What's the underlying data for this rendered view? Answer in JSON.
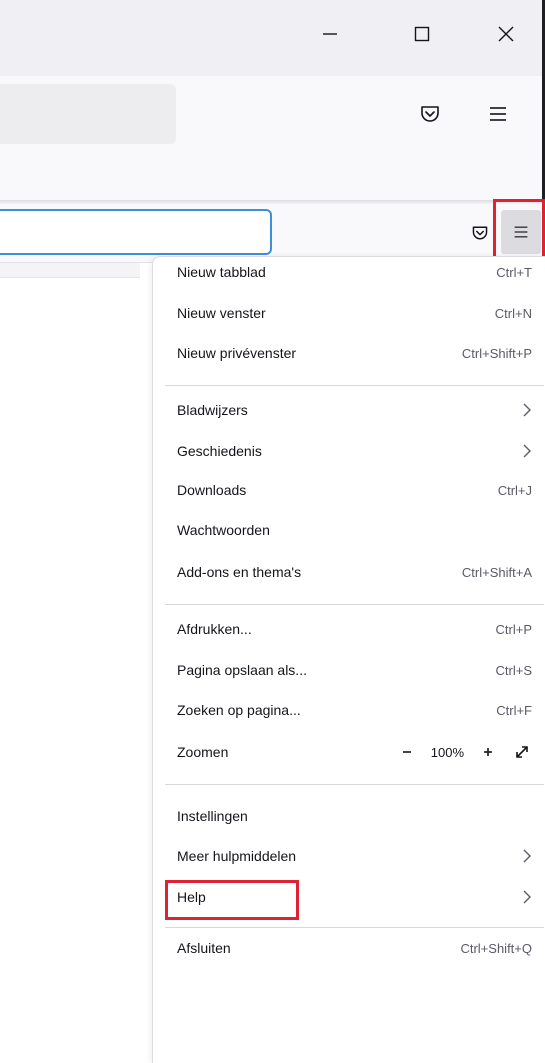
{
  "window": {
    "minimize_icon": "minimize-icon",
    "maximize_icon": "maximize-icon",
    "close_icon": "close-icon"
  },
  "toolbar": {
    "pocket_icon": "pocket-icon",
    "menu_icon": "hamburger-menu-icon"
  },
  "menu": {
    "items": [
      {
        "label": "Nieuw tabblad",
        "shortcut": "Ctrl+T"
      },
      {
        "label": "Nieuw venster",
        "shortcut": "Ctrl+N"
      },
      {
        "label": "Nieuw privévenster",
        "shortcut": "Ctrl+Shift+P"
      },
      {
        "label": "Bladwijzers",
        "submenu": true
      },
      {
        "label": "Geschiedenis",
        "submenu": true
      },
      {
        "label": "Downloads",
        "shortcut": "Ctrl+J"
      },
      {
        "label": "Wachtwoorden"
      },
      {
        "label": "Add-ons en thema's",
        "shortcut": "Ctrl+Shift+A"
      },
      {
        "label": "Afdrukken...",
        "shortcut": "Ctrl+P"
      },
      {
        "label": "Pagina opslaan als...",
        "shortcut": "Ctrl+S"
      },
      {
        "label": "Zoeken op pagina...",
        "shortcut": "Ctrl+F"
      },
      {
        "label": "Zoomen",
        "zoom": "100%"
      },
      {
        "label": "Instellingen"
      },
      {
        "label": "Meer hulpmiddelen",
        "submenu": true
      },
      {
        "label": "Help",
        "submenu": true
      },
      {
        "label": "Afsluiten",
        "shortcut": "Ctrl+Shift+Q"
      }
    ]
  },
  "colors": {
    "highlight": "#dd2233",
    "urlbar_focus": "#3f8ed8",
    "titlebar": "#f0f0f4"
  }
}
